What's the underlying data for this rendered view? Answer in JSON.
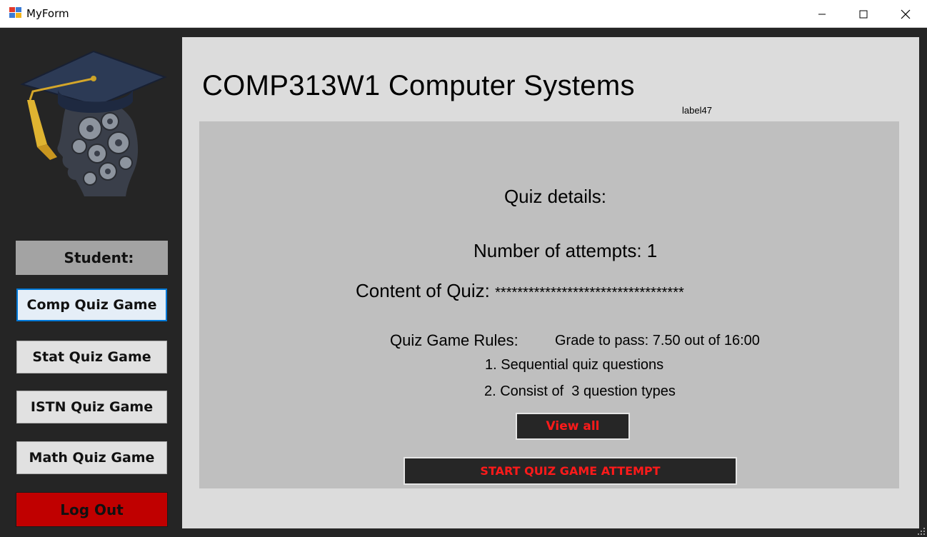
{
  "window": {
    "title": "MyForm",
    "icons": {
      "app": "windows-form-icon",
      "minimize": "minimize-icon",
      "maximize": "maximize-icon",
      "close": "close-icon"
    }
  },
  "sidebar": {
    "logo_icon": "graduation-head-gears-icon",
    "student_label": "Student:",
    "buttons": [
      {
        "label": "Comp Quiz Game",
        "active": true
      },
      {
        "label": "Stat Quiz Game",
        "active": false
      },
      {
        "label": "ISTN Quiz Game",
        "active": false
      },
      {
        "label": "Math Quiz Game",
        "active": false
      }
    ],
    "logout_label": "Log Out"
  },
  "main": {
    "course_title": "COMP313W1 Computer Systems",
    "label47": "label47",
    "quiz": {
      "details_heading": "Quiz details:",
      "attempts_label": "Number of attempts:",
      "attempts_value": "1",
      "content_label": "Content of Quiz:",
      "content_value": "**********************************",
      "rules_label": "Quiz Game Rules:",
      "grade_to_pass": "Grade to pass: 7.50 out of 16:00",
      "rule_1": "1. Sequential quiz questions",
      "rule_2": "2. Consist of  3 question types",
      "view_all_label": "View all",
      "start_label": "START QUIZ GAME ATTEMPT"
    }
  },
  "colors": {
    "sidebar_bg": "#252525",
    "panel_bg": "#dcdcdc",
    "quiz_panel_bg": "#bfbfbf",
    "logout_red": "#c00000",
    "accent_red_text": "#ff1a1a",
    "active_border": "#0078d7"
  }
}
